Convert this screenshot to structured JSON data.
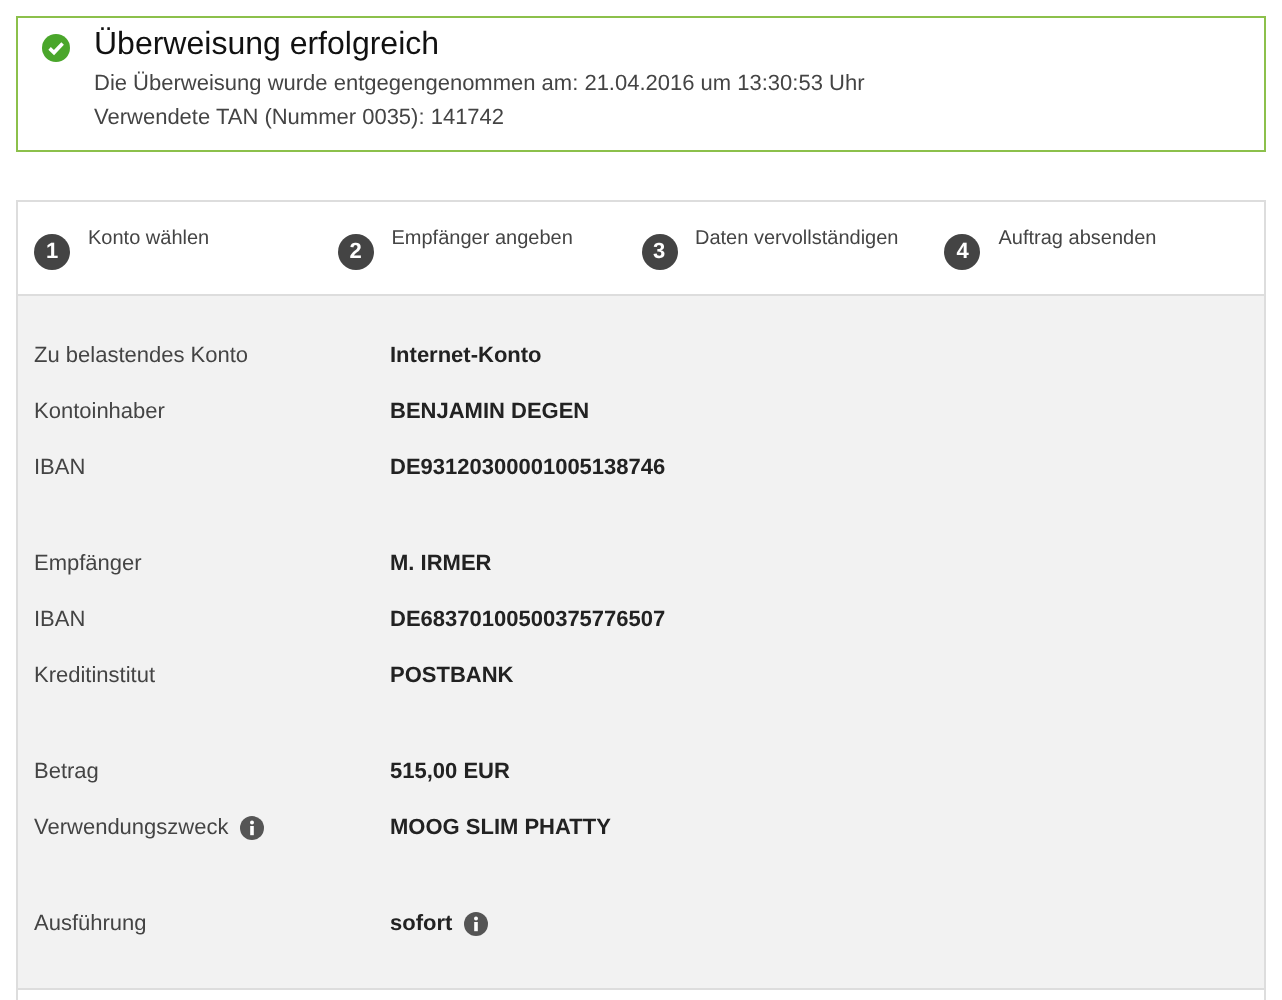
{
  "success": {
    "title": "Überweisung erfolgreich",
    "lines": [
      "Die Überweisung wurde entgegengenommen am: 21.04.2016 um 13:30:53 Uhr",
      "Verwendete TAN (Nummer 0035): 141742"
    ]
  },
  "steps": [
    {
      "number": "1",
      "label": "Konto wählen"
    },
    {
      "number": "2",
      "label": "Empfänger angeben"
    },
    {
      "number": "3",
      "label": "Daten vervollständigen"
    },
    {
      "number": "4",
      "label": "Auftrag absenden"
    }
  ],
  "groups": [
    {
      "rows": [
        {
          "label": "Zu belastendes Konto",
          "value": "Internet-Konto"
        },
        {
          "label": "Kontoinhaber",
          "value": "BENJAMIN DEGEN"
        },
        {
          "label": "IBAN",
          "value": "DE93120300001005138746"
        }
      ]
    },
    {
      "rows": [
        {
          "label": "Empfänger",
          "value": "M. IRMER"
        },
        {
          "label": "IBAN",
          "value": "DE68370100500375776507"
        },
        {
          "label": "Kreditinstitut",
          "value": "POSTBANK"
        }
      ]
    },
    {
      "rows": [
        {
          "label": "Betrag",
          "value": "515,00 EUR"
        },
        {
          "label": "Verwendungszweck",
          "value": "MOOG SLIM PHATTY",
          "label_info": true
        }
      ]
    },
    {
      "rows": [
        {
          "label": "Ausführung",
          "value": "sofort",
          "value_info": true
        }
      ]
    }
  ]
}
